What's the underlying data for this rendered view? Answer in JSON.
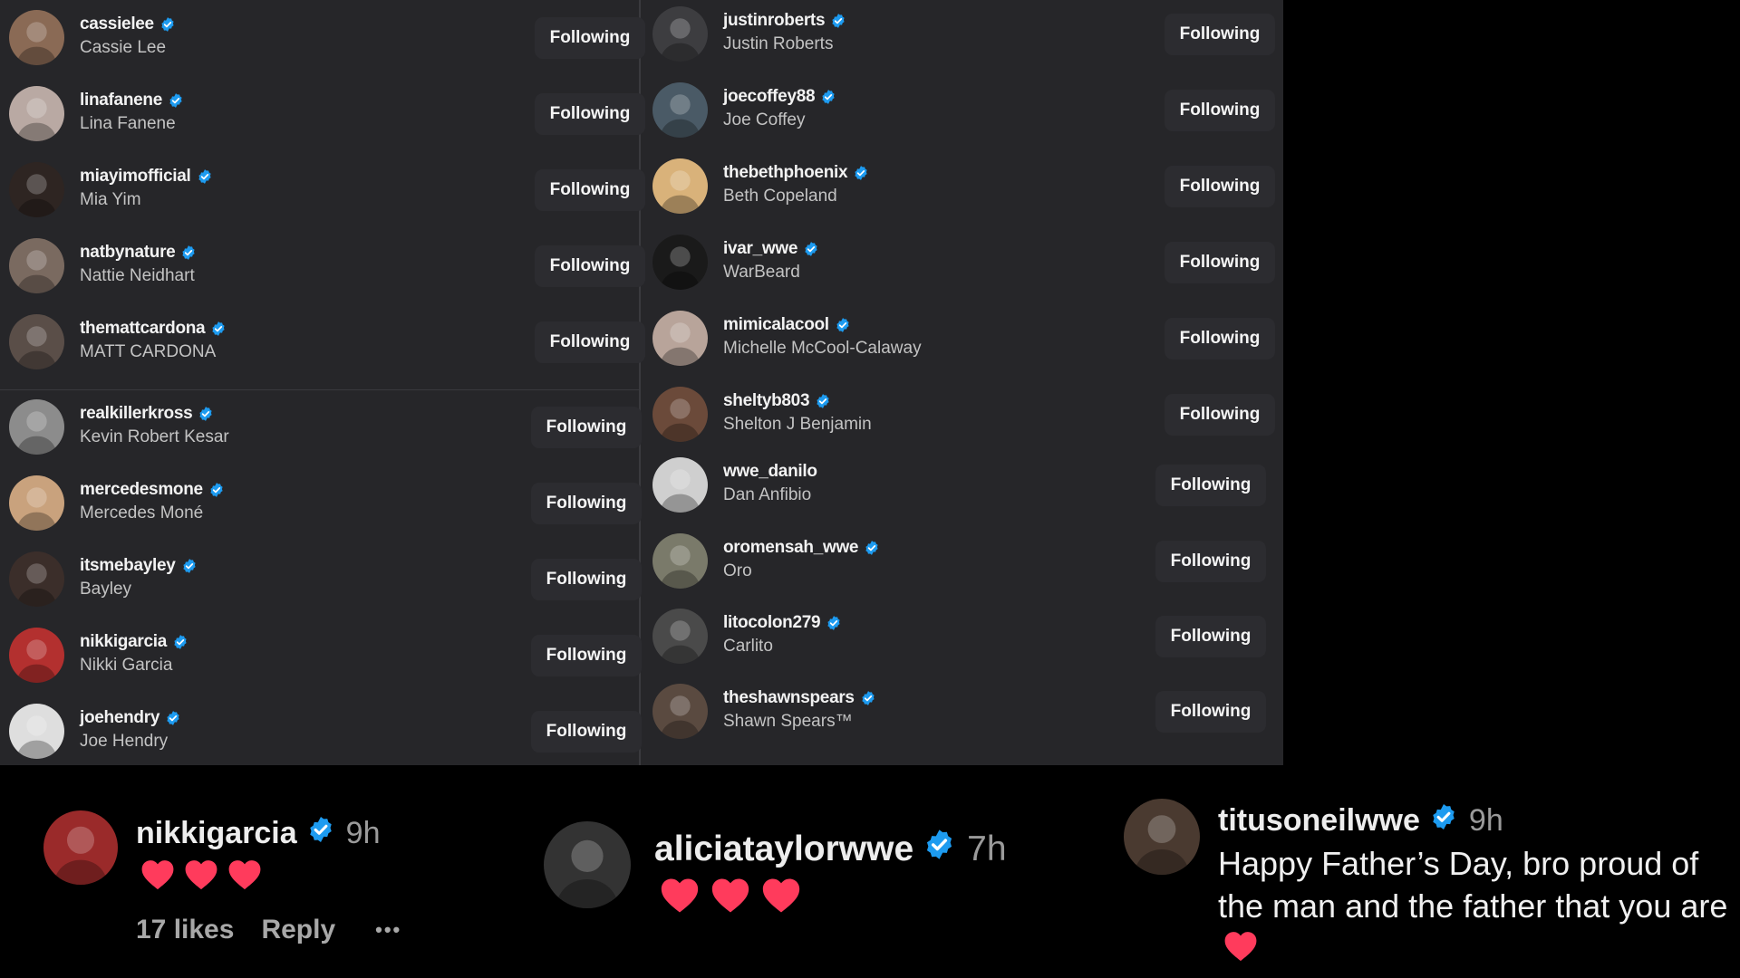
{
  "following_left": [
    {
      "username": "cassielee",
      "full_name": "Cassie Lee",
      "button": "Following",
      "avatar_color": "#8a6a55"
    },
    {
      "username": "linafanene",
      "full_name": "Lina Fanene",
      "button": "Following",
      "avatar_color": "#b9a9a3"
    },
    {
      "username": "miayimofficial",
      "full_name": "Mia Yim",
      "button": "Following",
      "avatar_color": "#2e2522"
    },
    {
      "username": "natbynature",
      "full_name": "Nattie Neidhart",
      "button": "Following",
      "avatar_color": "#7a6a60"
    },
    {
      "username": "themattcardona",
      "full_name": "MATT CARDONA",
      "button": "Following",
      "avatar_color": "#5a4e48"
    },
    {
      "username": "realkillerkross",
      "full_name": "Kevin Robert Kesar",
      "button": "Following",
      "avatar_color": "#8c8c8c"
    },
    {
      "username": "mercedesmone",
      "full_name": "Mercedes Moné",
      "button": "Following",
      "avatar_color": "#c9a27d"
    },
    {
      "username": "itsmebayley",
      "full_name": "Bayley",
      "button": "Following",
      "avatar_color": "#3b2e2a"
    },
    {
      "username": "nikkigarcia",
      "full_name": "Nikki Garcia",
      "button": "Following",
      "avatar_color": "#b3302f"
    },
    {
      "username": "joehendry",
      "full_name": "Joe Hendry",
      "button": "Following",
      "avatar_color": "#dedede"
    }
  ],
  "following_right": [
    {
      "username": "justinroberts",
      "full_name": "Justin Roberts",
      "button": "Following",
      "avatar_color": "#3d3d40"
    },
    {
      "username": "joecoffey88",
      "full_name": "Joe Coffey",
      "button": "Following",
      "avatar_color": "#4a5a66"
    },
    {
      "username": "thebethphoenix",
      "full_name": "Beth Copeland",
      "button": "Following",
      "avatar_color": "#d9b27a"
    },
    {
      "username": "ivar_wwe",
      "full_name": "WarBeard",
      "button": "Following",
      "avatar_color": "#1a1a1a"
    },
    {
      "username": "mimicalacool",
      "full_name": "Michelle McCool-Calaway",
      "button": "Following",
      "avatar_color": "#b8a49a"
    },
    {
      "username": "sheltyb803",
      "full_name": "Shelton J Benjamin",
      "button": "Following",
      "avatar_color": "#6b4a3a"
    },
    {
      "username": "wwe_danilo",
      "full_name": "Dan Anfibio",
      "button": "Following",
      "avatar_color": "#cfcfcf"
    },
    {
      "username": "oromensah_wwe",
      "full_name": "Oro",
      "button": "Following",
      "avatar_color": "#7a7a6a"
    },
    {
      "username": "litocolon279",
      "full_name": "Carlito",
      "button": "Following",
      "avatar_color": "#4a4a4a"
    },
    {
      "username": "theshawnspears",
      "full_name": "Shawn Spears™",
      "button": "Following",
      "avatar_color": "#5a4a40"
    }
  ],
  "comments": [
    {
      "username": "nikkigarcia",
      "time": "9h",
      "hearts": 3,
      "likes": "17 likes",
      "reply": "Reply",
      "more": "•••",
      "avatar_color": "#9a2a2a"
    },
    {
      "username": "aliciataylorwwe",
      "time": "7h",
      "hearts": 3,
      "avatar_color": "#333333"
    },
    {
      "username": "titusoneilwwe",
      "time": "9h",
      "text": "Happy Father’s Day, bro proud of the man and the father that you are",
      "hearts": 1,
      "avatar_color": "#4a3a30"
    }
  ],
  "colors": {
    "verified": "#1d9bf0",
    "heart": "#ff3b5c",
    "panel": "#262629"
  }
}
